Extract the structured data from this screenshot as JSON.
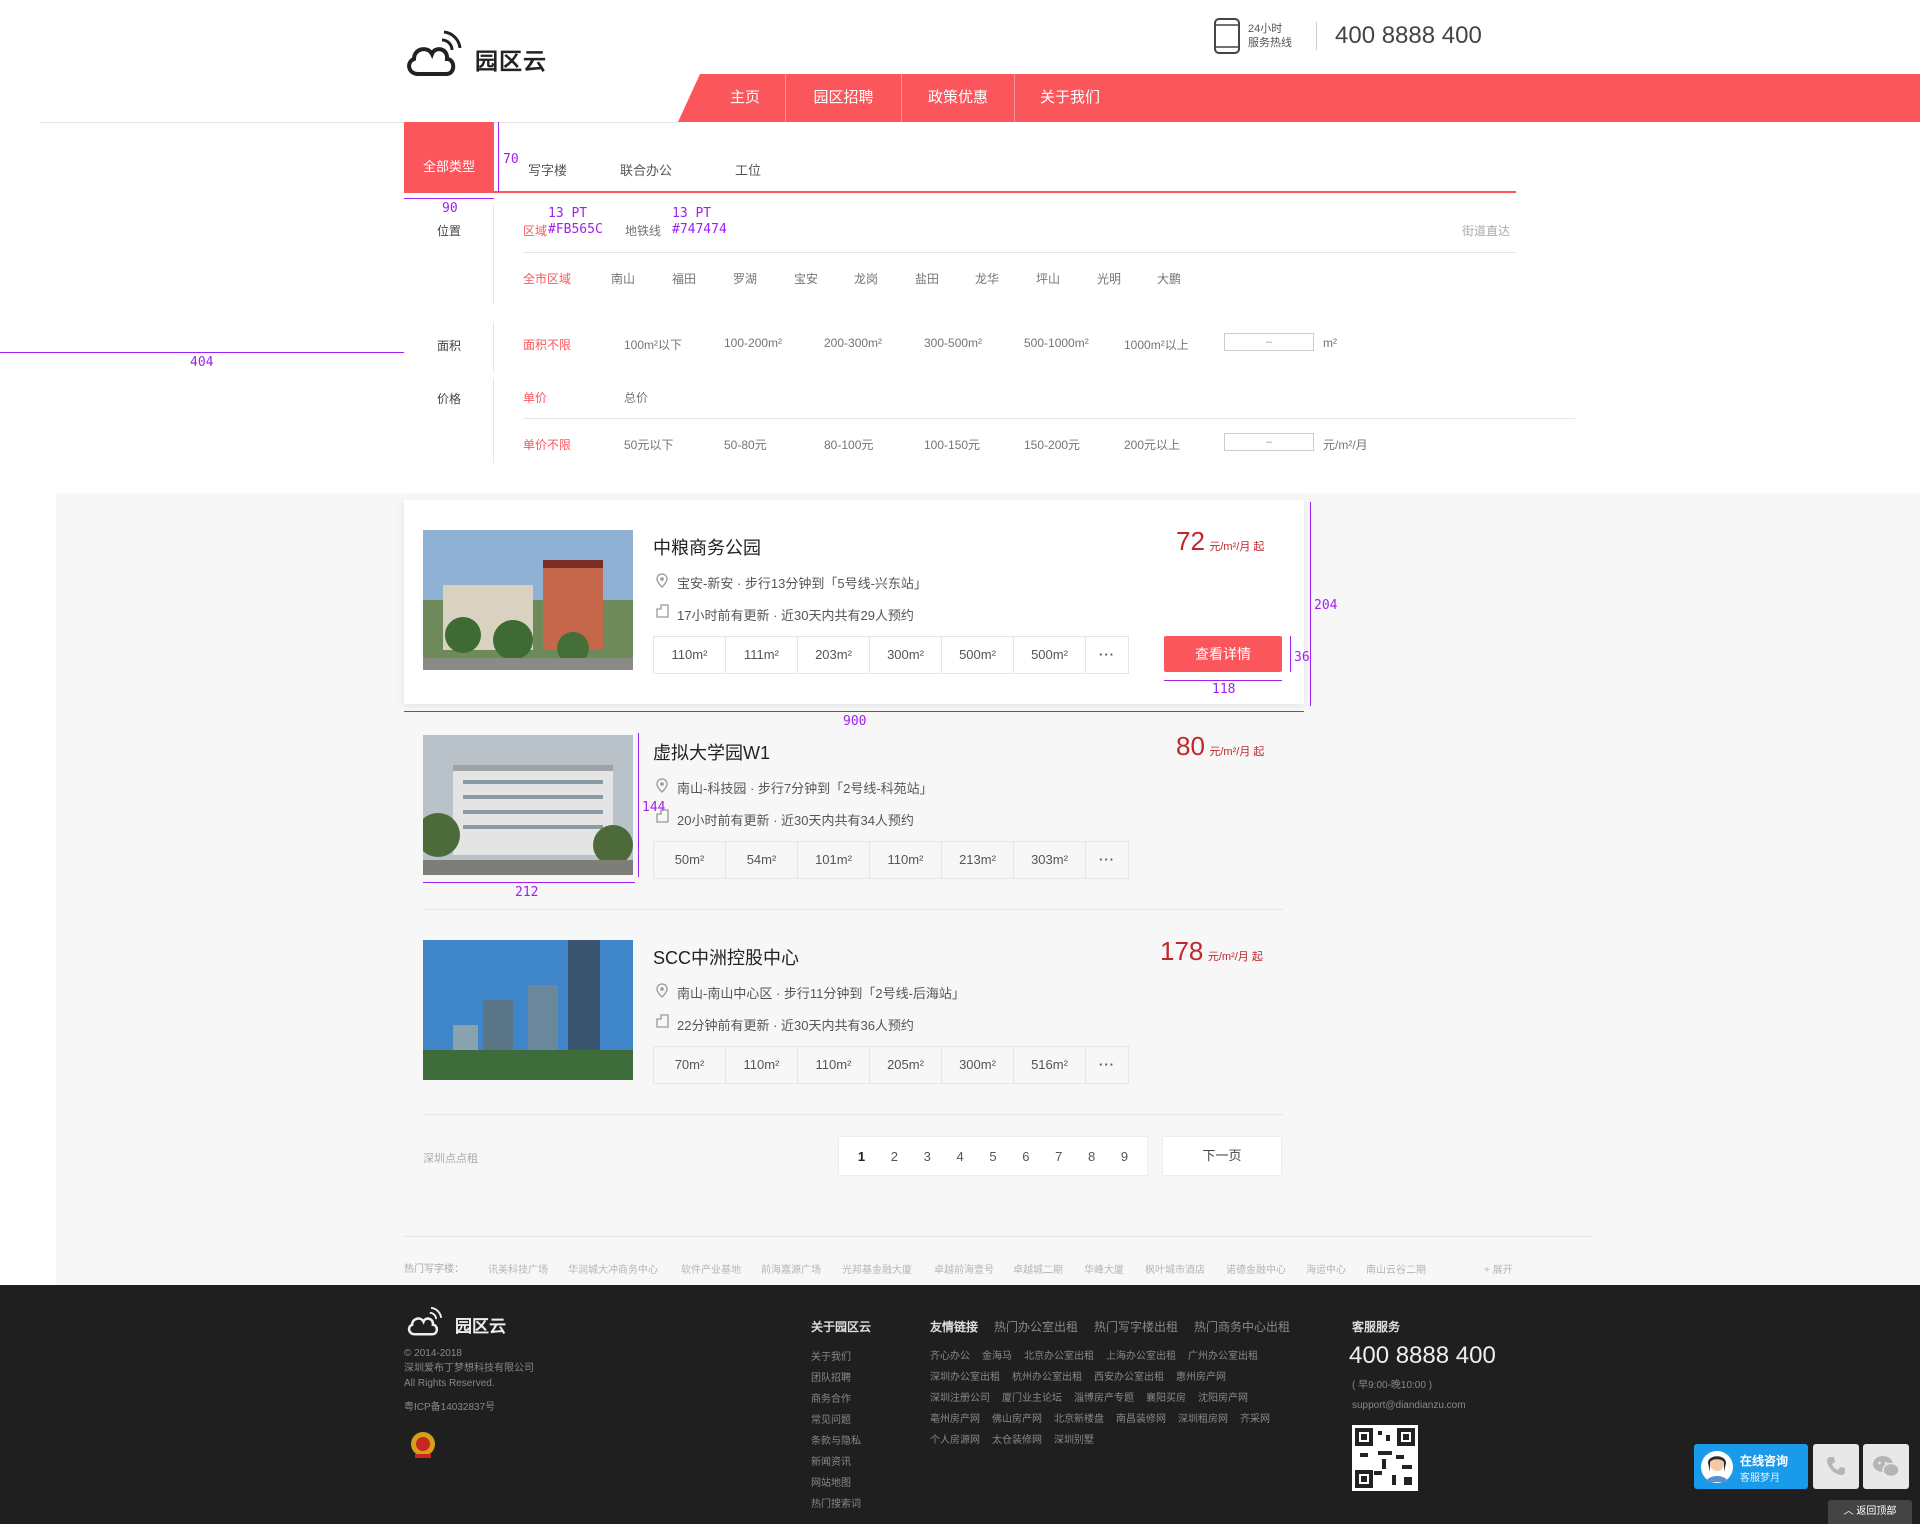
{
  "header": {
    "logo_text": "园区云",
    "hotline_small_1": "24小时",
    "hotline_small_2": "服务热线",
    "hotline_number": "400 8888 400"
  },
  "nav": {
    "items": [
      "主页",
      "园区招聘",
      "政策优惠",
      "关于我们"
    ]
  },
  "type_tabs": {
    "active": "全部类型",
    "items": [
      "写字楼",
      "联合办公",
      "工位"
    ]
  },
  "annotations": {
    "tab_height": "70",
    "tab_width": "90",
    "left_margin": "404",
    "font1_size": "13 PT",
    "font1_color": "#FB565C",
    "font2_size": "13 PT",
    "font2_color": "#747474",
    "card_height": "204",
    "button_height": "36",
    "button_width": "118",
    "card_width": "900",
    "thumb_height": "144",
    "thumb_width": "212"
  },
  "filters": {
    "location": {
      "label": "位置",
      "modes": [
        "区域",
        "地铁线"
      ],
      "street_link": "街道直达",
      "options": [
        "全市区域",
        "南山",
        "福田",
        "罗湖",
        "宝安",
        "龙岗",
        "盐田",
        "龙华",
        "坪山",
        "光明",
        "大鹏"
      ]
    },
    "area": {
      "label": "面积",
      "options": [
        "面积不限",
        "100m²以下",
        "100-200m²",
        "200-300m²",
        "300-500m²",
        "500-1000m²",
        "1000m²以上"
      ],
      "range_placeholder": "–",
      "unit": "m²"
    },
    "price": {
      "label": "价格",
      "modes": [
        "单价",
        "总价"
      ],
      "options": [
        "单价不限",
        "50元以下",
        "50-80元",
        "80-100元",
        "100-150元",
        "150-200元",
        "200元以上"
      ],
      "range_placeholder": "–",
      "unit": "元/m²/月"
    }
  },
  "listings": [
    {
      "title": "中粮商务公园",
      "location": "宝安-新安 · 步行13分钟到「5号线-兴东站」",
      "update": "17小时前有更新  · 近30天内共有29人预约",
      "price": "72",
      "unit": "元/m²/月 起",
      "sizes": [
        "110m²",
        "111m²",
        "203m²",
        "300m²",
        "500m²",
        "500m²",
        "···"
      ],
      "button": "查看详情"
    },
    {
      "title": "虚拟大学园W1",
      "location": "南山-科技园 · 步行7分钟到「2号线-科苑站」",
      "update": "20小时前有更新  · 近30天内共有34人预约",
      "price": "80",
      "unit": "元/m²/月 起",
      "sizes": [
        "50m²",
        "54m²",
        "101m²",
        "110m²",
        "213m²",
        "303m²",
        "···"
      ]
    },
    {
      "title": "SCC中洲控股中心",
      "location": "南山-南山中心区 · 步行11分钟到「2号线-后海站」",
      "update": "22分钟前有更新  · 近30天内共有36人预约",
      "price": "178",
      "unit": "元/m²/月 起",
      "sizes": [
        "70m²",
        "110m²",
        "110m²",
        "205m²",
        "300m²",
        "516m²",
        "···"
      ]
    }
  ],
  "pagination": {
    "site_label": "深圳点点租",
    "pages": [
      "1",
      "2",
      "3",
      "4",
      "5",
      "6",
      "7",
      "8",
      "9"
    ],
    "next": "下一页"
  },
  "hot": {
    "label": "热门写字楼：",
    "items": [
      "讯美科技广场",
      "华润城大冲商务中心",
      "软件产业基地",
      "前海嘉源广场",
      "光邦基金融大厦",
      "卓越前海壹号",
      "卓越城二期",
      "华峰大厦",
      "枫叶城市酒店",
      "诺德金融中心",
      "海运中心",
      "南山云谷二期"
    ],
    "expand": "+ 展开"
  },
  "footer": {
    "logo_text": "园区云",
    "copyright": "© 2014-2018",
    "company": "深圳爱布丁梦想科技有限公司",
    "rights": "All Rights Reserved.",
    "icp": "粤ICP备14032837号",
    "about_head": "关于园区云",
    "about_links": [
      "关于我们",
      "团队招聘",
      "商务合作",
      "常见问题",
      "条款与隐私",
      "新闻资讯",
      "网站地图",
      "热门搜索词"
    ],
    "friend_head": "友情链接",
    "friend_tabs": [
      "热门办公室出租",
      "热门写字楼出租",
      "热门商务中心出租"
    ],
    "friend_rows": [
      [
        "齐心办公",
        "金海马",
        "北京办公室出租",
        "上海办公室出租",
        "广州办公室出租"
      ],
      [
        "深圳办公室出租",
        "杭州办公室出租",
        "西安办公室出租",
        "惠州房产网"
      ],
      [
        "深圳注册公司",
        "厦门业主论坛",
        "淄博房产专题",
        "襄阳买房",
        "沈阳房产网"
      ],
      [
        "亳州房产网",
        "佛山房产网",
        "北京新楼盘",
        "南昌装修网",
        "深圳租房网",
        "齐采网"
      ],
      [
        "个人房源网",
        "太仓装修网",
        "深圳别墅"
      ]
    ],
    "service_head": "客服服务",
    "phone": "400 8888 400",
    "hours": "( 早9:00-晚10:00 )",
    "email": "support@diandianzu.com"
  },
  "float": {
    "consult": "在线咨询",
    "consult_sub": "客服梦月",
    "back_top": "返回顶部"
  },
  "colors": {
    "accent": "#FB565C",
    "price": "#c0272d",
    "annotation": "#a020f0",
    "footer_bg": "#1f1f1f"
  }
}
